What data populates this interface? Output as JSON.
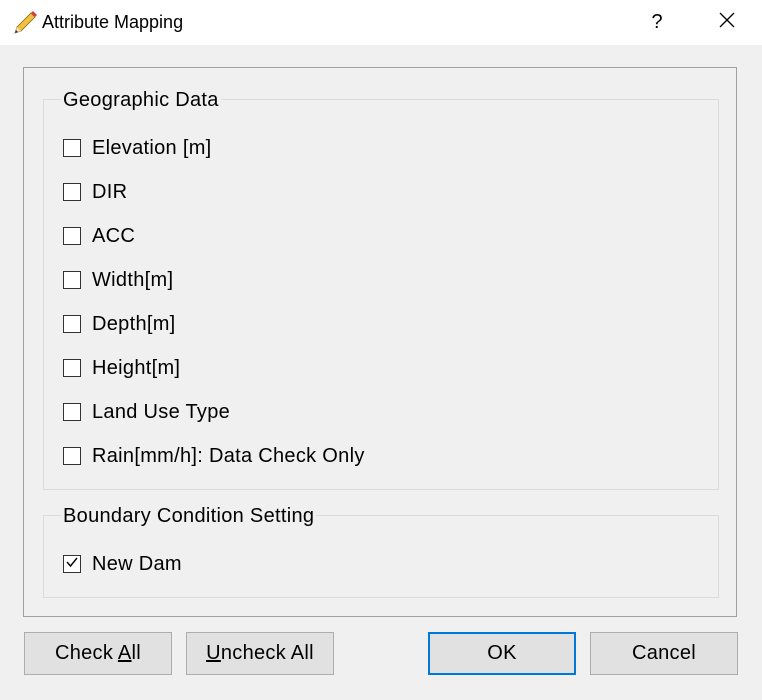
{
  "window": {
    "title": "Attribute Mapping",
    "help_label": "?"
  },
  "geographic": {
    "title": "Geographic Data",
    "items": [
      {
        "label": "Elevation [m]",
        "checked": false
      },
      {
        "label": "DIR",
        "checked": false
      },
      {
        "label": "ACC",
        "checked": false
      },
      {
        "label": "Width[m]",
        "checked": false
      },
      {
        "label": "Depth[m]",
        "checked": false
      },
      {
        "label": "Height[m]",
        "checked": false
      },
      {
        "label": "Land Use Type",
        "checked": false
      },
      {
        "label": "Rain[mm/h]: Data Check Only",
        "checked": false
      }
    ]
  },
  "boundary": {
    "title": "Boundary Condition Setting",
    "items": [
      {
        "label": "New Dam",
        "checked": true
      }
    ]
  },
  "buttons": {
    "check_all_pre": "Check ",
    "check_all_acc": "A",
    "check_all_post": "ll",
    "uncheck_all_acc": "U",
    "uncheck_all_post": "ncheck All",
    "ok": "OK",
    "cancel": "Cancel"
  }
}
